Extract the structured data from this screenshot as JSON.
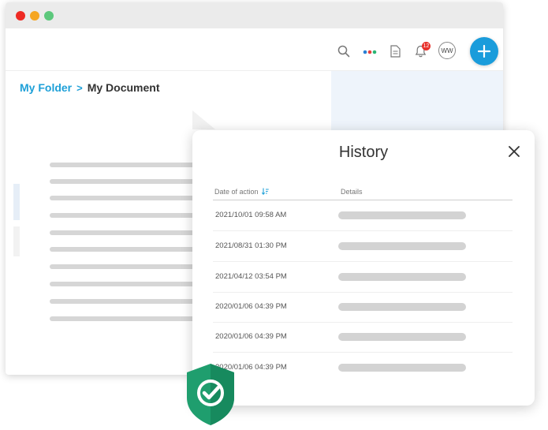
{
  "topbar": {
    "notification_count": "12",
    "avatar_initials": "WW",
    "icons": [
      "search-icon",
      "apps-dots-icon",
      "document-icon",
      "bell-icon"
    ],
    "add_icon": "plus-icon"
  },
  "breadcrumb": {
    "folder": "My Folder",
    "separator": ">",
    "current": "My Document"
  },
  "history": {
    "title": "History",
    "close_icon": "close-icon",
    "columns": {
      "date": "Date of action",
      "details": "Details"
    },
    "rows": [
      {
        "date": "2021/10/01 09:58 AM"
      },
      {
        "date": "2021/08/31 01:30 PM"
      },
      {
        "date": "2021/04/12 03:54 PM"
      },
      {
        "date": "2020/01/06 04:39 PM"
      },
      {
        "date": "2020/01/06 04:39 PM"
      },
      {
        "date": "2020/01/06 04:39 PM"
      }
    ]
  },
  "colors": {
    "accent": "#1a9cdb",
    "link": "#1ea0d8",
    "shield": "#1f9e6e",
    "badge": "#e8302a"
  },
  "badge_icon": "shield-check-icon"
}
